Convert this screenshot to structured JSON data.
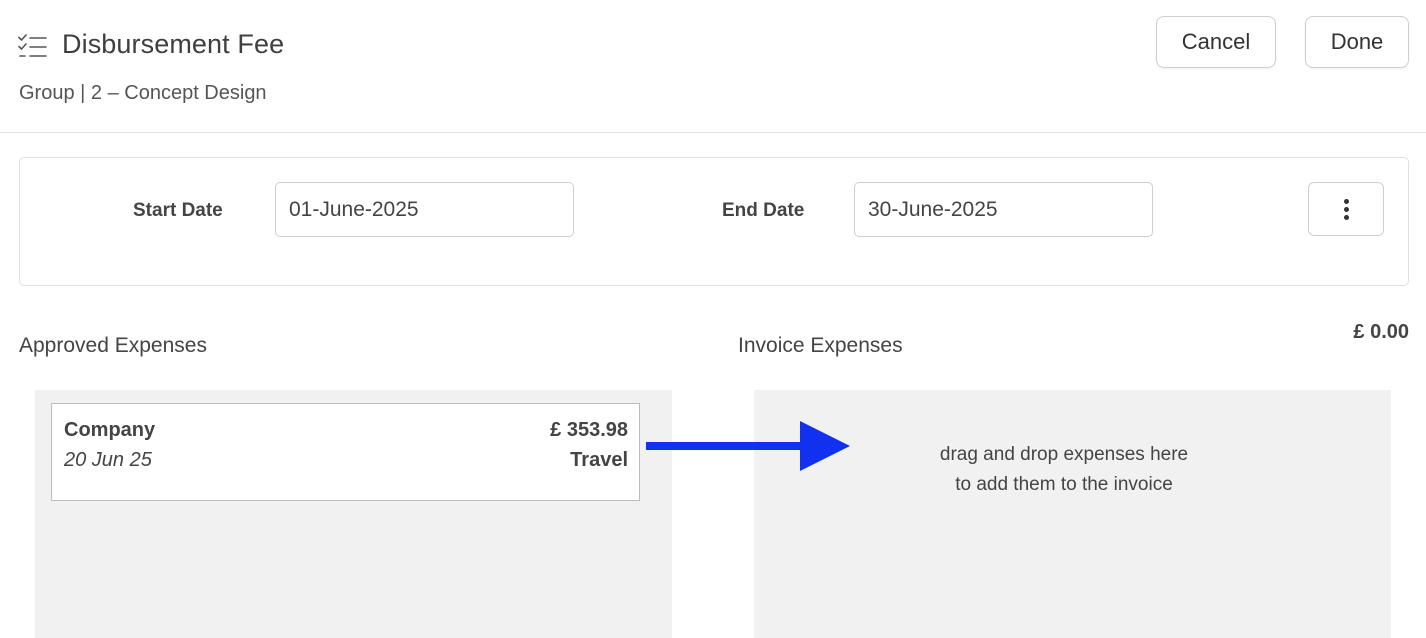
{
  "header": {
    "icon": "checklist-icon",
    "title": "Disbursement Fee",
    "subtitle": "Group | 2 – Concept Design",
    "cancel_label": "Cancel",
    "done_label": "Done"
  },
  "filters": {
    "start_date_label": "Start Date",
    "start_date_value": "01-June-2025",
    "end_date_label": "End Date",
    "end_date_value": "30-June-2025",
    "more_icon": "more-vertical-icon"
  },
  "approved": {
    "title": "Approved Expenses",
    "expenses": [
      {
        "name": "Company",
        "date": "20 Jun 25",
        "amount": "£ 353.98",
        "category": "Travel"
      }
    ]
  },
  "invoice": {
    "title": "Invoice Expenses",
    "total": "£ 0.00",
    "drop_hint_line1": "drag and drop expenses here",
    "drop_hint_line2": "to add them to the invoice"
  },
  "colors": {
    "arrow": "#1230f0",
    "drop_area_bg": "#f1f1f1",
    "border": "#cfcfcf"
  }
}
